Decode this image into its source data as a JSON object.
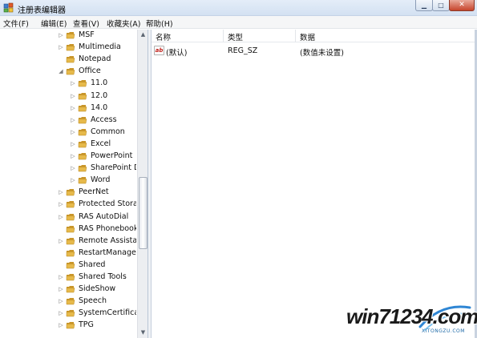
{
  "window": {
    "title": "注册表编辑器",
    "buttons": {
      "minimize": "▁",
      "maximize": "□",
      "close": "✕"
    }
  },
  "menu": [
    "文件(F)",
    "编辑(E)",
    "查看(V)",
    "收藏夹(A)",
    "帮助(H)"
  ],
  "tree": [
    {
      "label": "MSF",
      "expander": "▷"
    },
    {
      "label": "Multimedia",
      "expander": "▷"
    },
    {
      "label": "Notepad",
      "expander": ""
    },
    {
      "label": "Office",
      "expander": "◢"
    },
    {
      "label": "11.0",
      "expander": "▷"
    },
    {
      "label": "12.0",
      "expander": "▷"
    },
    {
      "label": "14.0",
      "expander": "▷"
    },
    {
      "label": "Access",
      "expander": "▷"
    },
    {
      "label": "Common",
      "expander": "▷"
    },
    {
      "label": "Excel",
      "expander": "▷"
    },
    {
      "label": "PowerPoint",
      "expander": "▷"
    },
    {
      "label": "SharePoint D",
      "expander": "▷"
    },
    {
      "label": "Word",
      "expander": "▷"
    },
    {
      "label": "PeerNet",
      "expander": "▷"
    },
    {
      "label": "Protected Storag",
      "expander": "▷"
    },
    {
      "label": "RAS AutoDial",
      "expander": "▷"
    },
    {
      "label": "RAS Phonebook",
      "expander": ""
    },
    {
      "label": "Remote Assistan",
      "expander": "▷"
    },
    {
      "label": "RestartManager",
      "expander": ""
    },
    {
      "label": "Shared",
      "expander": ""
    },
    {
      "label": "Shared Tools",
      "expander": "▷"
    },
    {
      "label": "SideShow",
      "expander": "▷"
    },
    {
      "label": "Speech",
      "expander": "▷"
    },
    {
      "label": "SystemCertificate",
      "expander": "▷"
    },
    {
      "label": "TPG",
      "expander": "▷"
    }
  ],
  "list": {
    "columns": [
      "名称",
      "类型",
      "数据"
    ],
    "rows": [
      {
        "name": "(默认)",
        "type": "REG_SZ",
        "data": "(数值未设置)"
      }
    ]
  },
  "watermark": {
    "text": "win71234.com",
    "url": "XITONGZU.COM"
  },
  "colors": {
    "folder": "#e6b94a",
    "title_bar": "#dbe6f4",
    "close": "#c6442c"
  },
  "icons": {
    "app": "regedit-icon",
    "value": "string-value-icon",
    "folder": "folder-icon"
  }
}
